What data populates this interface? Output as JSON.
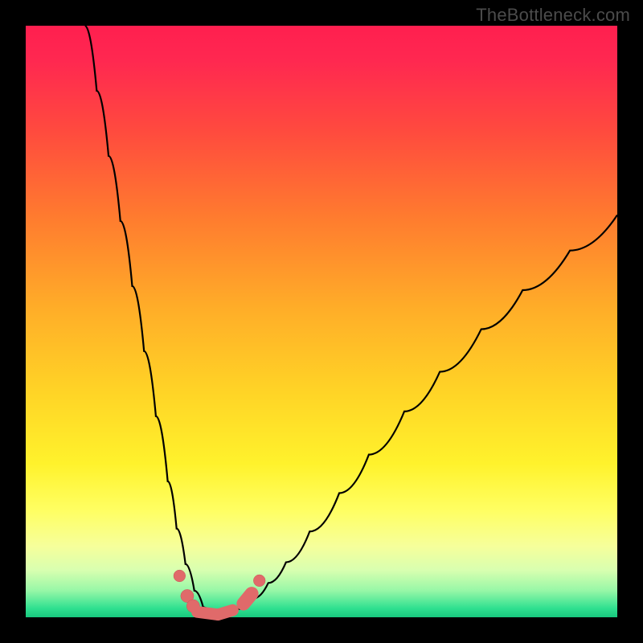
{
  "watermark": "TheBottleneck.com",
  "colors": {
    "gradient_stops": [
      {
        "offset": 0.0,
        "color": "#ff1f4f"
      },
      {
        "offset": 0.06,
        "color": "#ff2850"
      },
      {
        "offset": 0.18,
        "color": "#ff4b3e"
      },
      {
        "offset": 0.32,
        "color": "#ff7a2f"
      },
      {
        "offset": 0.48,
        "color": "#ffae28"
      },
      {
        "offset": 0.62,
        "color": "#ffd426"
      },
      {
        "offset": 0.74,
        "color": "#fff22c"
      },
      {
        "offset": 0.82,
        "color": "#ffff63"
      },
      {
        "offset": 0.88,
        "color": "#f6ff9b"
      },
      {
        "offset": 0.92,
        "color": "#d9ffb0"
      },
      {
        "offset": 0.955,
        "color": "#97f7a7"
      },
      {
        "offset": 0.985,
        "color": "#2fe090"
      },
      {
        "offset": 1.0,
        "color": "#18c87e"
      }
    ],
    "curve": "#000000",
    "marker_fill": "#e06a6a",
    "marker_stroke": "#c85858"
  },
  "chart_data": {
    "type": "line",
    "title": "",
    "xlabel": "",
    "ylabel": "",
    "xlim": [
      0,
      100
    ],
    "ylim": [
      0,
      100
    ],
    "series": [
      {
        "name": "left-branch",
        "x": [
          10,
          12,
          14,
          16,
          18,
          20,
          22,
          24,
          25.5,
          27,
          28.5,
          30,
          31.5,
          32.5
        ],
        "y": [
          100,
          89,
          78,
          67,
          56,
          45,
          34,
          23,
          15,
          9,
          4.5,
          1.7,
          0.5,
          0.3
        ]
      },
      {
        "name": "right-branch",
        "x": [
          32.5,
          34,
          36,
          38.5,
          41,
          44,
          48,
          53,
          58,
          64,
          70,
          77,
          84,
          92,
          100
        ],
        "y": [
          0.3,
          0.6,
          1.4,
          3.2,
          5.8,
          9.3,
          14.5,
          21,
          27.5,
          34.8,
          41.5,
          48.7,
          55.3,
          62,
          68
        ]
      }
    ],
    "markers": [
      {
        "name": "pt-a",
        "x": 26.0,
        "y": 7.0,
        "r": 1.0
      },
      {
        "name": "pt-b",
        "x": 27.3,
        "y": 3.6,
        "r": 1.1
      },
      {
        "name": "pt-c",
        "x": 28.3,
        "y": 1.9,
        "r": 1.1
      },
      {
        "name": "seg-d",
        "shape": "capsule",
        "x1": 29.0,
        "y1": 0.9,
        "x2": 32.5,
        "y2": 0.45,
        "w": 2.0
      },
      {
        "name": "seg-e",
        "shape": "capsule",
        "x1": 32.5,
        "y1": 0.45,
        "x2": 35.0,
        "y2": 1.2,
        "w": 2.0
      },
      {
        "name": "seg-f",
        "shape": "capsule",
        "x1": 36.8,
        "y1": 2.3,
        "x2": 38.2,
        "y2": 4.0,
        "w": 2.3
      },
      {
        "name": "pt-g",
        "x": 39.5,
        "y": 6.2,
        "r": 1.0
      }
    ]
  }
}
